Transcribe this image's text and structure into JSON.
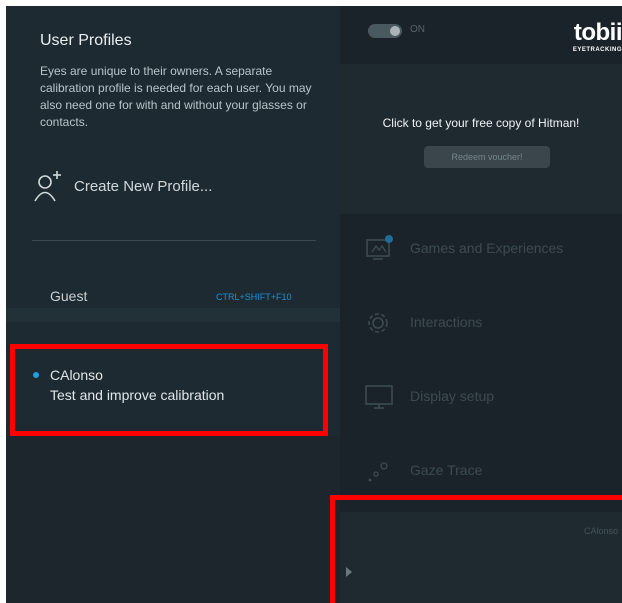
{
  "profiles_panel": {
    "title": "User Profiles",
    "description": "Eyes are unique to their owners. A separate calibration profile is needed for each user. You may also need one for with and without your glasses or contacts.",
    "create_label": "Create New Profile...",
    "guest": {
      "name": "Guest",
      "shortcut": "CTRL+SHIFT+F10"
    },
    "active_profile": {
      "name": "CAlonso",
      "action": "Test and improve calibration"
    }
  },
  "header": {
    "toggle_label": "ON",
    "brand_name": "tobii",
    "brand_sub": "EYETRACKING"
  },
  "promo": {
    "text": "Click to get your free copy of Hitman!",
    "button_label": "Redeem voucher!"
  },
  "nav": {
    "items": [
      {
        "label": "Games and Experiences",
        "icon": "games-icon"
      },
      {
        "label": "Interactions",
        "icon": "gear-icon"
      },
      {
        "label": "Display setup",
        "icon": "monitor-icon"
      },
      {
        "label": "Gaze Trace",
        "icon": "gaze-trace-icon"
      }
    ]
  },
  "footer": {
    "user_label": "CAlonso"
  },
  "colors": {
    "accent": "#1ea0e6",
    "highlight": "#ff0000",
    "panel_bg": "#1e2a31"
  }
}
